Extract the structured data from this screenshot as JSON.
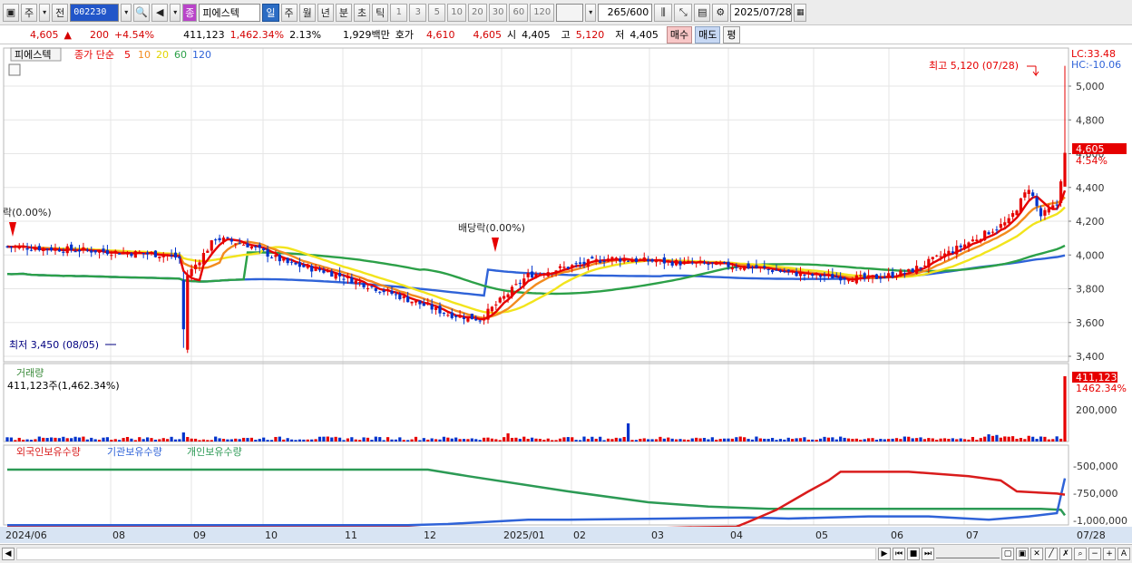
{
  "toolbar": {
    "tab_main": "주",
    "tab_prev": "전",
    "stock_code": "002230",
    "stock_name": "피에스텍",
    "name_badge": "종",
    "periods": [
      "일",
      "주",
      "월",
      "년",
      "분",
      "초",
      "틱"
    ],
    "active_period": "일",
    "intervals": [
      "1",
      "3",
      "5",
      "10",
      "20",
      "30",
      "60",
      "120"
    ],
    "count_value": "265",
    "count_total": "/600",
    "date": "2025/07/28"
  },
  "quote": {
    "price": "4,605",
    "change": "200",
    "change_pct": "+4.54%",
    "volume": "411,123",
    "volume_pct": "1,462.34%",
    "turnover": "2.13%",
    "amount": "1,929백만",
    "bid_label": "호가",
    "bid1": "4,610",
    "bid2": "4,605",
    "open_label": "시",
    "open": "4,405",
    "high_label": "고",
    "high": "5,120",
    "low_label": "저",
    "low": "4,405",
    "buy_label": "매수",
    "sell_label": "매도",
    "eval_label": "평"
  },
  "legend": {
    "stock_name": "피에스텍",
    "ma_prefix": "종가 단순",
    "ma5": "5",
    "ma10": "10",
    "ma20": "20",
    "ma60": "60",
    "ma120": "120"
  },
  "price_panel": {
    "lc": "LC:33.48",
    "hc": "HC:-10.06",
    "high_annot": "최고 5,120 (07/28)",
    "low_annot": "최저 3,450 (08/05)",
    "div_annot1": "락(0.00%)",
    "div_annot2": "배당락(0.00%)",
    "last_price": "4,605",
    "last_pct": "4.54%",
    "y_ticks": [
      "5,000",
      "4,800",
      "4,600",
      "4,400",
      "4,200",
      "4,000",
      "3,800",
      "3,600",
      "3,400"
    ]
  },
  "volume_panel": {
    "title": "거래량",
    "value": "411,123주(1,462.34%)",
    "tick": "200,000",
    "last_value": "411,123",
    "last_pct": "1462.34%"
  },
  "holding_panel": {
    "s1": "외국인보유수량",
    "s2": "기관보유수량",
    "s3": "개인보유수량",
    "ticks": [
      "-500,000",
      "-750,000",
      "-1,000,000"
    ]
  },
  "x_axis": [
    "2024/06",
    "08",
    "09",
    "10",
    "11",
    "12",
    "2025/01",
    "02",
    "03",
    "04",
    "05",
    "06",
    "07",
    "07/28"
  ],
  "colors": {
    "up": "#e60000",
    "down": "#0033cc",
    "ma5": "#e60000",
    "ma10": "#f28b1e",
    "ma20": "#f2e41c",
    "ma60": "#2ca048",
    "ma120": "#2f63d8",
    "foreign": "#d91c1c",
    "inst": "#2f63d8",
    "indiv": "#2c9a55"
  },
  "chart_data": {
    "type": "candlestick",
    "ylim": [
      3400,
      5120
    ],
    "high": 5120,
    "low": 3450,
    "last": 4605,
    "keypoints": [
      {
        "date": "2024/06",
        "price": 4050
      },
      {
        "date": "2024/07",
        "price": 4000
      },
      {
        "date": "2024/08/05",
        "price": 3450
      },
      {
        "date": "2024/08",
        "price": 4100
      },
      {
        "date": "2024/10",
        "price": 3750
      },
      {
        "date": "2024/11",
        "price": 3650
      },
      {
        "date": "2024/12",
        "price": 3980
      },
      {
        "date": "2025/01",
        "price": 3980
      },
      {
        "date": "2025/03",
        "price": 3900
      },
      {
        "date": "2025/04",
        "price": 3850
      },
      {
        "date": "2025/05",
        "price": 3920
      },
      {
        "date": "2025/06",
        "price": 4100
      },
      {
        "date": "2025/06/25",
        "price": 4400
      },
      {
        "date": "2025/07/28",
        "price": 4605
      }
    ],
    "holdings_ylim": [
      -1050000,
      -350000
    ]
  }
}
